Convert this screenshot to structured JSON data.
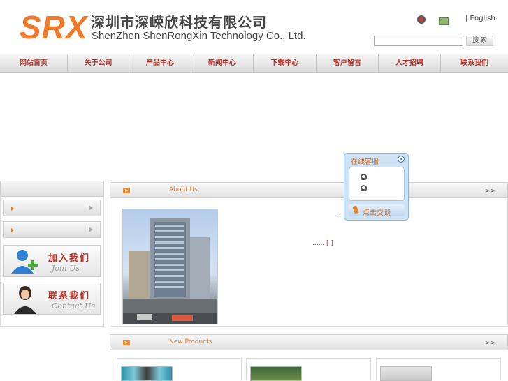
{
  "header": {
    "logo_mark": "SRX",
    "company_cn": "深圳市深嵘欣科技有限公司",
    "company_en": "ShenZhen ShenRongXin Technology Co., Ltd.",
    "lang_link": "| English",
    "search_button": "搜 索",
    "search_value": "",
    "icons": [
      "home-icon",
      "mail-icon"
    ]
  },
  "nav": {
    "items": [
      "网站首页",
      "关于公司",
      "产品中心",
      "新闻中心",
      "下载中心",
      "客户留言",
      "人才招聘",
      "联系我们"
    ]
  },
  "left": {
    "banners": [
      {
        "cn": "加入我们",
        "en": "Join Us"
      },
      {
        "cn": "联系我们",
        "en": "Contact Us"
      }
    ]
  },
  "about": {
    "title": "About Us",
    "more": ">>",
    "dots_top": "..",
    "dots_text": "......",
    "bracket": "[ ]"
  },
  "products": {
    "title": "New Products",
    "more": ">>"
  },
  "online_service": {
    "title": "在线客服",
    "footer": "点击交谈"
  },
  "colors": {
    "brand_orange": "#f07a2a",
    "nav_text": "#b5332a",
    "float_bg": "#cfe3f7"
  }
}
